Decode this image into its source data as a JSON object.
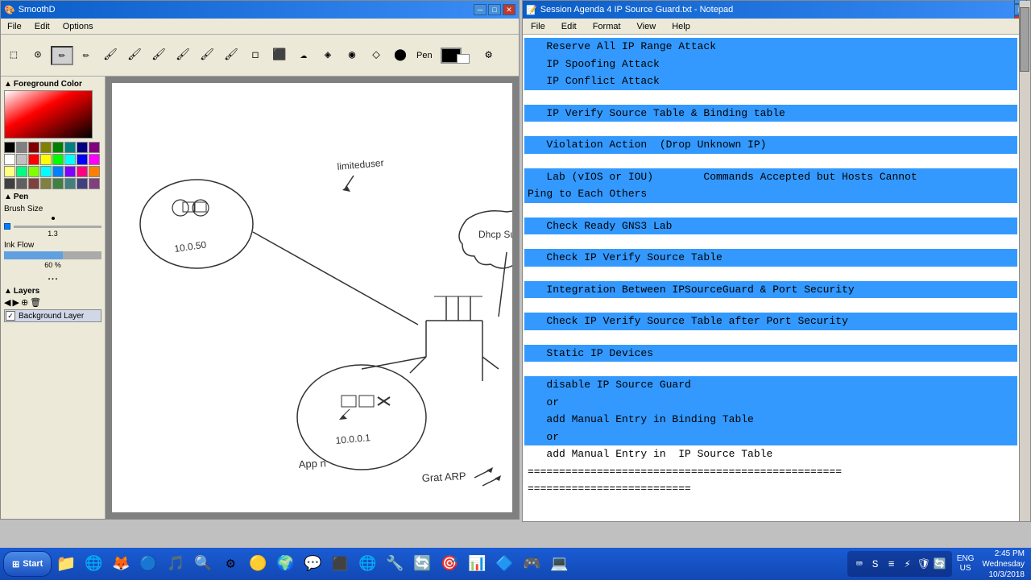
{
  "paint": {
    "title": "SmoothD",
    "menu": [
      "File",
      "Edit",
      "Options"
    ],
    "toolbar_label": "Pen",
    "left_panel": {
      "foreground_label": "Foreground Color",
      "pen_label": "Pen",
      "brush_size_label": "Brush Size",
      "ink_flow_label": "Ink Flow",
      "ink_flow_value": "60 %",
      "dots": "...",
      "layers_label": "Layers",
      "background_layer_label": "Background Layer"
    },
    "colors": [
      "#000000",
      "#808080",
      "#800000",
      "#808000",
      "#008000",
      "#008080",
      "#000080",
      "#800080",
      "#ffffff",
      "#c0c0c0",
      "#ff0000",
      "#ffff00",
      "#00ff00",
      "#00ffff",
      "#0000ff",
      "#ff00ff",
      "#ffff80",
      "#00ff80",
      "#80ff00",
      "#00ffff",
      "#0080ff",
      "#8000ff",
      "#ff0080",
      "#ff8000",
      "#404040",
      "#606060",
      "#804040",
      "#808040",
      "#408040",
      "#408080",
      "#404080",
      "#804080"
    ]
  },
  "notepad": {
    "title": "Session Agenda 4 IP Source Guard.txt - Notepad",
    "menu": [
      "File",
      "Edit",
      "Format",
      "View",
      "Help"
    ],
    "lines": [
      {
        "text": "   Reserve All IP Range Attack",
        "highlight": true
      },
      {
        "text": "   IP Spoofing Attack",
        "highlight": true
      },
      {
        "text": "   IP Conflict Attack",
        "highlight": true
      },
      {
        "text": "",
        "highlight": false
      },
      {
        "text": "   IP Verify Source Table & Binding table",
        "highlight": true
      },
      {
        "text": "",
        "highlight": false
      },
      {
        "text": "   Violation Action  (Drop Unknown IP)",
        "highlight": true
      },
      {
        "text": "",
        "highlight": false
      },
      {
        "text": "   Lab (vIOS or IOU)        Commands Accepted but Hosts Cannot",
        "highlight": true
      },
      {
        "text": "Ping to Each Others",
        "highlight": true
      },
      {
        "text": "",
        "highlight": false
      },
      {
        "text": "   Check Ready GNS3 Lab",
        "highlight": true
      },
      {
        "text": "",
        "highlight": false
      },
      {
        "text": "   Check IP Verify Source Table",
        "highlight": true
      },
      {
        "text": "",
        "highlight": false
      },
      {
        "text": "   Integration Between IPSourceGuard & Port Security",
        "highlight": true
      },
      {
        "text": "",
        "highlight": false
      },
      {
        "text": "   Check IP Verify Source Table after Port Security",
        "highlight": true
      },
      {
        "text": "",
        "highlight": false
      },
      {
        "text": "   Static IP Devices",
        "highlight": true
      },
      {
        "text": "",
        "highlight": false
      },
      {
        "text": "   disable IP Source Guard",
        "highlight": true
      },
      {
        "text": "   or",
        "highlight": true
      },
      {
        "text": "   add Manual Entry in Binding Table",
        "highlight": true
      },
      {
        "text": "   or",
        "highlight": true
      },
      {
        "text": "   add Manual Entry in  IP Source Table",
        "highlight": false
      },
      {
        "text": "==================================================",
        "highlight": false
      },
      {
        "text": "==========================",
        "highlight": false
      }
    ],
    "cursor_after_line": 25
  },
  "taskbar": {
    "start_label": "Start",
    "icons": [
      "🪟",
      "📁",
      "🌐",
      "🦊",
      "🔵",
      "🎵",
      "🔍",
      "🔧",
      "🟡",
      "🌍",
      "💬",
      "🎮",
      "🔄",
      "💻",
      "📊",
      "🔷",
      "🎯",
      "🖥"
    ],
    "lang": "ENG\nUS",
    "time": "2:45 PM",
    "date": "Wednesday\n10/3/2018"
  }
}
